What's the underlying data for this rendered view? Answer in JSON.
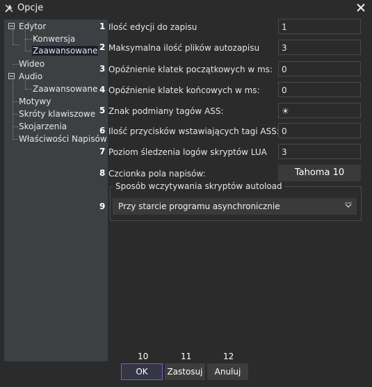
{
  "window": {
    "title": "Opcje"
  },
  "tree": [
    {
      "label": "Edytor"
    },
    {
      "label": "Konwersja"
    },
    {
      "label": "Zaawansowane"
    },
    {
      "label": "Wideo"
    },
    {
      "label": "Audio"
    },
    {
      "label": "Zaawansowane"
    },
    {
      "label": "Motywy"
    },
    {
      "label": "Skróty klawiszowe"
    },
    {
      "label": "Skojarzenia"
    },
    {
      "label": "Właściwości Napisów"
    }
  ],
  "options": [
    {
      "num": "1",
      "label": "Ilość edycji do zapisu",
      "value": "1"
    },
    {
      "num": "2",
      "label": "Maksymalna ilość plików autozapisu",
      "value": "3"
    },
    {
      "num": "3",
      "label": "Opóźnienie klatek początkowych w ms:",
      "value": "0"
    },
    {
      "num": "4",
      "label": "Opóźnienie klatek końcowych w ms:",
      "value": "0"
    },
    {
      "num": "5",
      "label": "Znak podmiany tagów ASS:",
      "value": "☀"
    },
    {
      "num": "6",
      "label": "Ilość przycisków wstawiających tagi ASS:",
      "value": "0"
    },
    {
      "num": "7",
      "label": "Poziom śledzenia logów skryptów LUA",
      "value": "3"
    },
    {
      "num": "8",
      "label": "Czcionka pola napisów:",
      "value": "Tahoma 10"
    }
  ],
  "autoload": {
    "num": "9",
    "title": "Sposób wczytywania skryptów autoload",
    "selected": "Przy starcie programu asynchronicznie"
  },
  "buttons": [
    {
      "num": "10",
      "label": "OK"
    },
    {
      "num": "11",
      "label": "Zastosuj"
    },
    {
      "num": "12",
      "label": "Anuluj"
    }
  ]
}
